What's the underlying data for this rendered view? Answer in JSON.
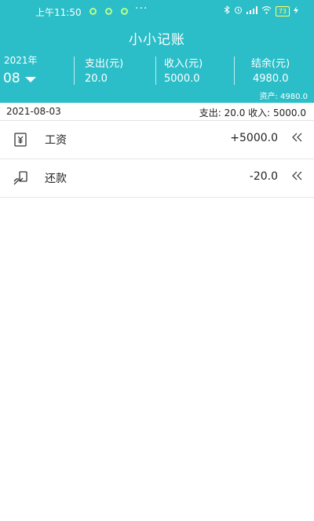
{
  "status_bar": {
    "time": "上午11:50",
    "more": "···",
    "battery": "73"
  },
  "header": {
    "title": "小小记账",
    "year": "2021年",
    "month": "08",
    "expense_label": "支出(元)",
    "expense_value": "20.0",
    "income_label": "收入(元)",
    "income_value": "5000.0",
    "balance_label": "结余(元)",
    "balance_value": "4980.0",
    "assets": "资产: 4980.0"
  },
  "day": {
    "date": "2021-08-03",
    "summary": "支出: 20.0 收入: 5000.0"
  },
  "records": [
    {
      "name": "工资",
      "amount": "+5000.0",
      "icon": "salary-icon"
    },
    {
      "name": "还款",
      "amount": "-20.0",
      "icon": "repayment-icon"
    }
  ],
  "colors": {
    "header_bg": "#2bbec8"
  }
}
